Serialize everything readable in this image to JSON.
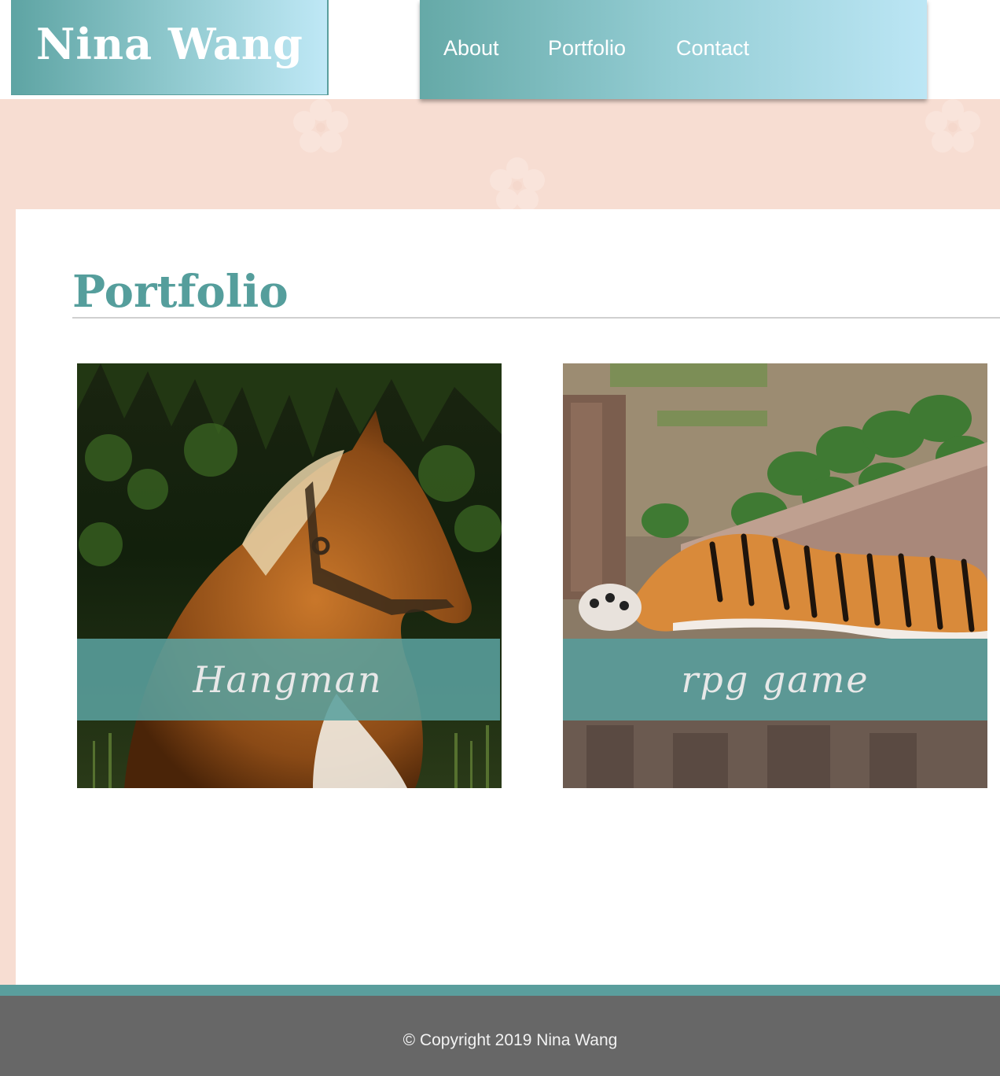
{
  "header": {
    "brand": "Nina Wang",
    "nav": [
      {
        "label": "About"
      },
      {
        "label": "Portfolio"
      },
      {
        "label": "Contact"
      }
    ]
  },
  "main": {
    "title": "Portfolio",
    "projects": [
      {
        "caption": "Hangman",
        "image": "horse-photo"
      },
      {
        "caption": "rpg game",
        "image": "tiger-photo"
      }
    ]
  },
  "footer": {
    "copyright": "© Copyright 2019 Nina Wang"
  },
  "colors": {
    "accent": "#5a9e9d",
    "background": "#f7ddd2",
    "footer": "#676767"
  }
}
